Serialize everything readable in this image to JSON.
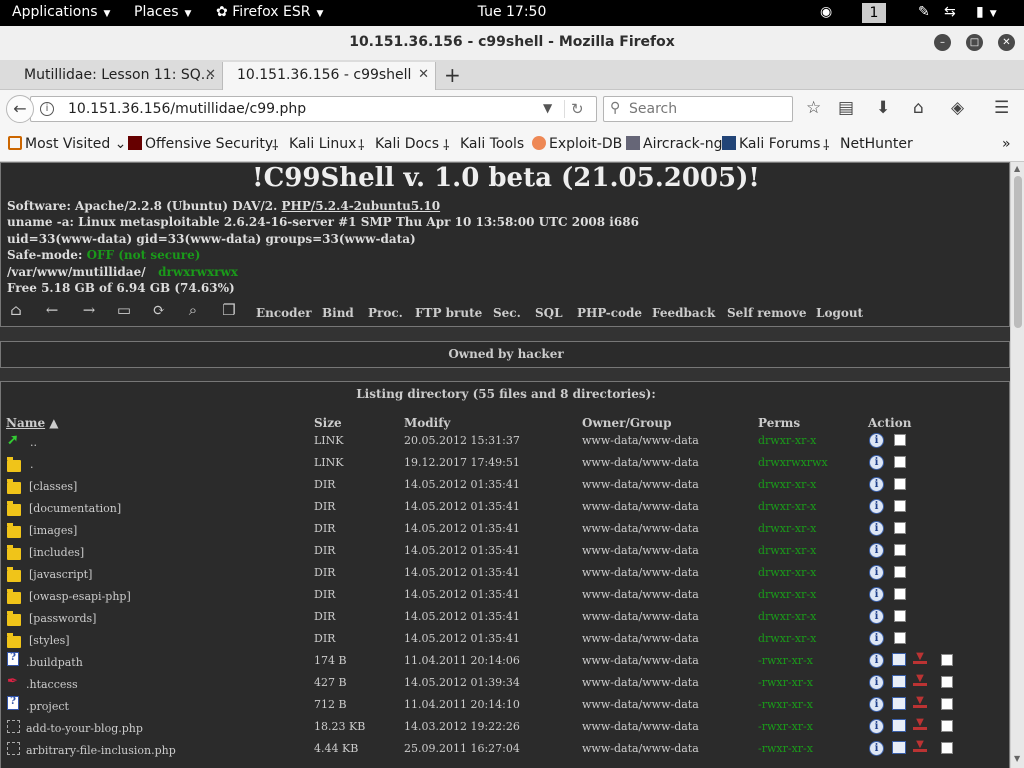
{
  "topbar": {
    "applications": "Applications",
    "places": "Places",
    "firefox": "Firefox ESR",
    "clock": "Tue 17:50",
    "workspace": "1"
  },
  "window": {
    "title": "10.151.36.156 - c99shell - Mozilla Firefox"
  },
  "tabs": [
    {
      "label": "Mutillidae: Lesson 11: SQ..."
    },
    {
      "label": "10.151.36.156 - c99shell"
    }
  ],
  "nav": {
    "url": "10.151.36.156/mutillidae/c99.php",
    "search_placeholder": "Search"
  },
  "bookmarks": [
    {
      "label": "Most Visited",
      "icon": "gear-icon"
    },
    {
      "label": "Offensive Security",
      "icon": "offsec-icon"
    },
    {
      "label": "Kali Linux",
      "icon": "kali-icon"
    },
    {
      "label": "Kali Docs",
      "icon": "kali-icon"
    },
    {
      "label": "Kali Tools",
      "icon": "kali-icon"
    },
    {
      "label": "Exploit-DB",
      "icon": "exploitdb-icon"
    },
    {
      "label": "Aircrack-ng",
      "icon": "aircrack-icon"
    },
    {
      "label": "Kali Forums",
      "icon": "forums-icon"
    },
    {
      "label": "NetHunter",
      "icon": "kali-icon"
    }
  ],
  "shell": {
    "title": "!C99Shell v. 1.0 beta (21.05.2005)!",
    "software_prefix": "Software: Apache/2.2.8 (Ubuntu) DAV/2.",
    "software_php": "PHP/5.2.4-2ubuntu5.10",
    "uname": "uname -a: Linux metasploitable 2.6.24-16-server #1 SMP Thu Apr 10 13:58:00 UTC 2008 i686",
    "uid": "uid=33(www-data) gid=33(www-data) groups=33(www-data)",
    "safe_mode_label": "Safe-mode:",
    "safe_mode_value": "OFF (not secure)",
    "cwd": "/var/www/mutillidae/",
    "cwd_perms": "drwxrwxrwx",
    "free": "Free 5.18 GB of 6.94 GB (74.63%)",
    "menu": [
      "Encoder",
      "Bind",
      "Proc.",
      "FTP brute",
      "Sec.",
      "SQL",
      "PHP-code",
      "Feedback",
      "Self remove",
      "Logout"
    ],
    "owned": "Owned by hacker",
    "listing": "Listing directory (55 files and 8 directories):"
  },
  "columns": {
    "name": "Name",
    "size": "Size",
    "modify": "Modify",
    "owner": "Owner/Group",
    "perms": "Perms",
    "action": "Action"
  },
  "rows": [
    {
      "name": "..",
      "size": "LINK",
      "modify": "20.05.2012 15:31:37",
      "owner": "www-data/www-data",
      "perms": "drwxr-xr-x",
      "kind": "up"
    },
    {
      "name": ".",
      "size": "LINK",
      "modify": "19.12.2017 17:49:51",
      "owner": "www-data/www-data",
      "perms": "drwxrwxrwx",
      "kind": "folder"
    },
    {
      "name": "[classes]",
      "size": "DIR",
      "modify": "14.05.2012 01:35:41",
      "owner": "www-data/www-data",
      "perms": "drwxr-xr-x",
      "kind": "folder"
    },
    {
      "name": "[documentation]",
      "size": "DIR",
      "modify": "14.05.2012 01:35:41",
      "owner": "www-data/www-data",
      "perms": "drwxr-xr-x",
      "kind": "folder"
    },
    {
      "name": "[images]",
      "size": "DIR",
      "modify": "14.05.2012 01:35:41",
      "owner": "www-data/www-data",
      "perms": "drwxr-xr-x",
      "kind": "folder"
    },
    {
      "name": "[includes]",
      "size": "DIR",
      "modify": "14.05.2012 01:35:41",
      "owner": "www-data/www-data",
      "perms": "drwxr-xr-x",
      "kind": "folder"
    },
    {
      "name": "[javascript]",
      "size": "DIR",
      "modify": "14.05.2012 01:35:41",
      "owner": "www-data/www-data",
      "perms": "drwxr-xr-x",
      "kind": "folder"
    },
    {
      "name": "[owasp-esapi-php]",
      "size": "DIR",
      "modify": "14.05.2012 01:35:41",
      "owner": "www-data/www-data",
      "perms": "drwxr-xr-x",
      "kind": "folder"
    },
    {
      "name": "[passwords]",
      "size": "DIR",
      "modify": "14.05.2012 01:35:41",
      "owner": "www-data/www-data",
      "perms": "drwxr-xr-x",
      "kind": "folder"
    },
    {
      "name": "[styles]",
      "size": "DIR",
      "modify": "14.05.2012 01:35:41",
      "owner": "www-data/www-data",
      "perms": "drwxr-xr-x",
      "kind": "folder"
    },
    {
      "name": ".buildpath",
      "size": "174 B",
      "modify": "11.04.2011 20:14:06",
      "owner": "www-data/www-data",
      "perms": "-rwxr-xr-x",
      "kind": "q"
    },
    {
      "name": ".htaccess",
      "size": "427 B",
      "modify": "14.05.2012 01:39:34",
      "owner": "www-data/www-data",
      "perms": "-rwxr-xr-x",
      "kind": "feather"
    },
    {
      "name": ".project",
      "size": "712 B",
      "modify": "11.04.2011 20:14:10",
      "owner": "www-data/www-data",
      "perms": "-rwxr-xr-x",
      "kind": "q"
    },
    {
      "name": "add-to-your-blog.php",
      "size": "18.23 KB",
      "modify": "14.03.2012 19:22:26",
      "owner": "www-data/www-data",
      "perms": "-rwxr-xr-x",
      "kind": "php"
    },
    {
      "name": "arbitrary-file-inclusion.php",
      "size": "4.44 KB",
      "modify": "25.09.2011 16:27:04",
      "owner": "www-data/www-data",
      "perms": "-rwxr-xr-x",
      "kind": "php"
    }
  ]
}
